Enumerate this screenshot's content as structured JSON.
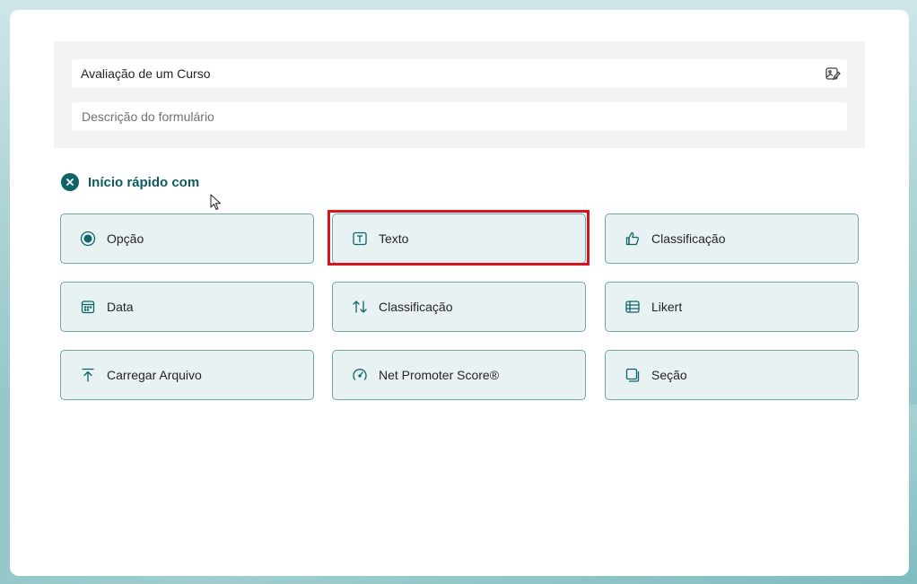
{
  "form": {
    "title": "Avaliação de um Curso",
    "description_placeholder": "Descrição do formulário",
    "image_button_icon": "image-edit-icon"
  },
  "quick_start": {
    "label": "Início rápido com",
    "close_icon": "close-icon"
  },
  "tiles": [
    {
      "label": "Opção",
      "icon": "radio-icon"
    },
    {
      "label": "Texto",
      "icon": "text-icon"
    },
    {
      "label": "Classificação",
      "icon": "thumbs-up-icon"
    },
    {
      "label": "Data",
      "icon": "calendar-icon"
    },
    {
      "label": "Classificação",
      "icon": "sort-arrows-icon"
    },
    {
      "label": "Likert",
      "icon": "likert-grid-icon"
    },
    {
      "label": "Carregar Arquivo",
      "icon": "upload-icon"
    },
    {
      "label": "Net Promoter Score®",
      "icon": "gauge-icon"
    },
    {
      "label": "Seção",
      "icon": "section-icon"
    }
  ],
  "colors": {
    "accent": "#0f6467",
    "tile_bg": "#e8f2f3",
    "tile_border": "#6fa8ab",
    "highlight": "#d9141b"
  }
}
